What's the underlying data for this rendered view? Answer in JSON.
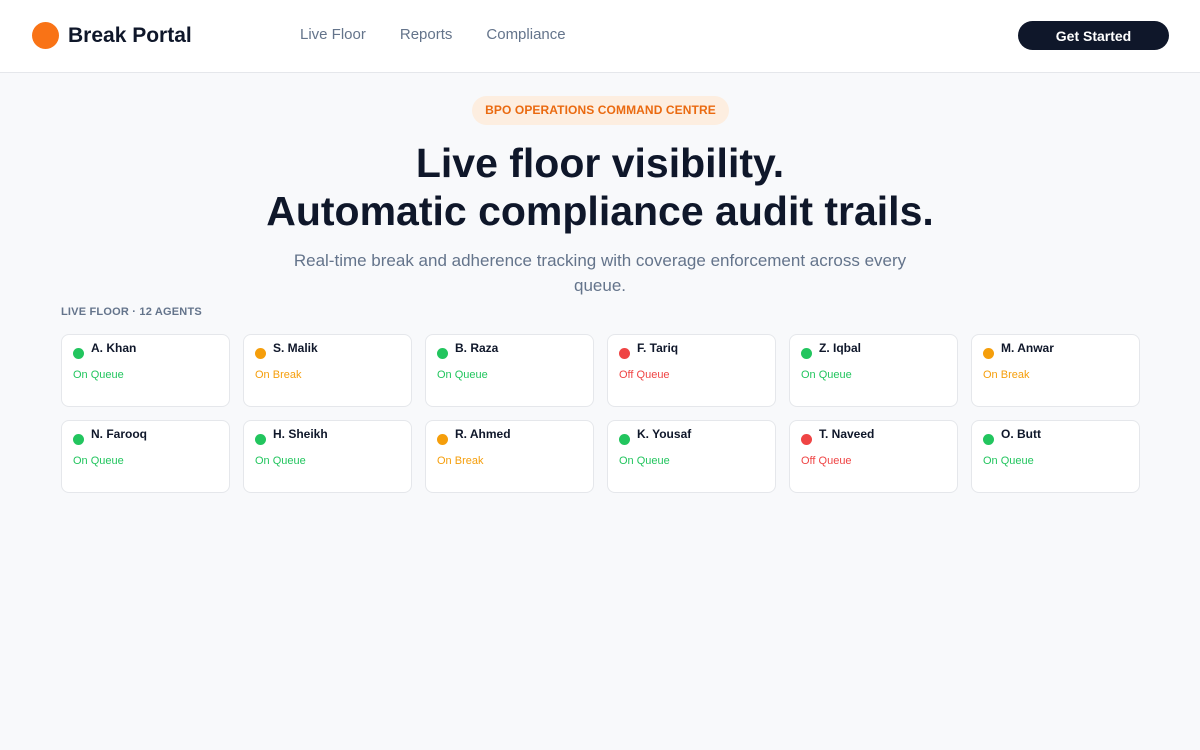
{
  "brand": {
    "name": "Break Portal",
    "logo_color": "#f97316"
  },
  "nav": {
    "items": [
      "Live Floor",
      "Reports",
      "Compliance"
    ]
  },
  "header": {
    "cta_label": "Get Started"
  },
  "hero": {
    "badge": "BPO OPERATIONS COMMAND CENTRE",
    "title_line1": "Live floor visibility.",
    "title_line2": "Automatic compliance audit trails.",
    "subtitle": "Real-time break and adherence tracking with coverage enforcement across every queue."
  },
  "floor": {
    "label": "LIVE FLOOR · 12 AGENTS",
    "agents": [
      {
        "name": "A. Khan",
        "status": "On Queue"
      },
      {
        "name": "S. Malik",
        "status": "On Break"
      },
      {
        "name": "B. Raza",
        "status": "On Queue"
      },
      {
        "name": "F. Tariq",
        "status": "Off Queue"
      },
      {
        "name": "Z. Iqbal",
        "status": "On Queue"
      },
      {
        "name": "M. Anwar",
        "status": "On Break"
      },
      {
        "name": "N. Farooq",
        "status": "On Queue"
      },
      {
        "name": "H. Sheikh",
        "status": "On Queue"
      },
      {
        "name": "R. Ahmed",
        "status": "On Break"
      },
      {
        "name": "K. Yousaf",
        "status": "On Queue"
      },
      {
        "name": "T. Naveed",
        "status": "Off Queue"
      },
      {
        "name": "O. Butt",
        "status": "On Queue"
      }
    ]
  },
  "status_colors": {
    "On Queue": "#22c55e",
    "On Break": "#f59e0b",
    "Off Queue": "#ef4444"
  }
}
